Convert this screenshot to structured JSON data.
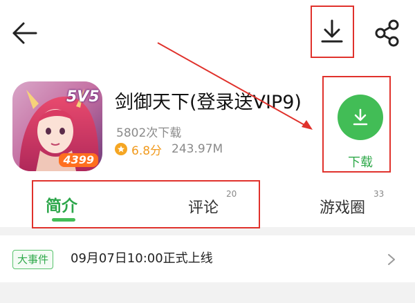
{
  "toolbar": {
    "back_icon": "arrow-left-icon",
    "download_icon": "download-tray-icon",
    "share_icon": "share-icon"
  },
  "app": {
    "title": "剑御天下(登录送VIP9)",
    "downloads": "5802次下载",
    "rating": "6.8分",
    "size": "243.97M",
    "icon_badge": "4399",
    "icon_overlay": "5V5"
  },
  "download_button": {
    "label": "下载"
  },
  "tabs": [
    {
      "label": "简介",
      "count": "",
      "active": true
    },
    {
      "label": "评论",
      "count": "20",
      "active": false
    },
    {
      "label": "游戏圈",
      "count": "33",
      "active": false
    }
  ],
  "event": {
    "tag": "大事件",
    "text": "09月07日10:00正式上线"
  },
  "colors": {
    "accent_green": "#42bd56",
    "annotation_red": "#e0312b",
    "rating_orange": "#f19a1d"
  }
}
